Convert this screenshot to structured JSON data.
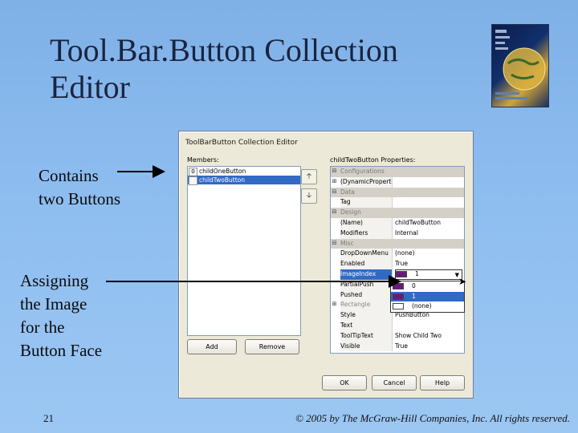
{
  "slide": {
    "title_line1": "Tool.Bar.Button Collection",
    "title_line2": "Editor",
    "annotation_buttons_line1": "Contains",
    "annotation_buttons_line2": "two Buttons",
    "annotation_image_lines": [
      "Assigning",
      "the Image",
      "for the",
      "Button Face"
    ],
    "slide_number": "21",
    "copyright": "© 2005 by The McGraw-Hill Companies, Inc. All rights reserved."
  },
  "dialog": {
    "title": "ToolBarButton Collection Editor",
    "members_label": "Members:",
    "members": [
      {
        "index": "0",
        "name": "childOneButton",
        "selected": false
      },
      {
        "index": "1",
        "name": "childTwoButton",
        "selected": true
      }
    ],
    "move_up_icon": "up-arrow-icon",
    "move_down_icon": "down-arrow-icon",
    "add_label": "Add",
    "remove_label": "Remove",
    "properties_label": "childTwoButton Properties:",
    "properties": [
      {
        "type": "category",
        "name": "Configurations"
      },
      {
        "type": "prop",
        "name": "(DynamicPropertie",
        "value": ""
      },
      {
        "type": "category",
        "name": "Data"
      },
      {
        "type": "prop",
        "name": "Tag",
        "value": ""
      },
      {
        "type": "category",
        "name": "Design"
      },
      {
        "type": "prop",
        "name": "(Name)",
        "value": "childTwoButton"
      },
      {
        "type": "prop",
        "name": "Modifiers",
        "value": "Internal"
      },
      {
        "type": "category",
        "name": "Misc"
      },
      {
        "type": "prop",
        "name": "DropDownMenu",
        "value": "(none)"
      },
      {
        "type": "prop",
        "name": "Enabled",
        "value": "True"
      },
      {
        "type": "prop",
        "name": "ImageIndex",
        "value": "1",
        "selected": true
      },
      {
        "type": "prop",
        "name": "PartialPush",
        "value": ""
      },
      {
        "type": "prop",
        "name": "Pushed",
        "value": ""
      },
      {
        "type": "prop",
        "name": "Rectangle",
        "value": ""
      },
      {
        "type": "prop",
        "name": "Style",
        "value": "PushButton"
      },
      {
        "type": "prop",
        "name": "Text",
        "value": ""
      },
      {
        "type": "prop",
        "name": "ToolTipText",
        "value": "Show Child Two"
      },
      {
        "type": "prop",
        "name": "Visible",
        "value": "True"
      }
    ],
    "image_dropdown": [
      "0",
      "1",
      "(none)"
    ],
    "ok_label": "OK",
    "cancel_label": "Cancel",
    "help_label": "Help"
  },
  "colors": {
    "selection": "#316ac5",
    "dialog_bg": "#ece9d8",
    "slide_bg": "#8cbcef"
  }
}
